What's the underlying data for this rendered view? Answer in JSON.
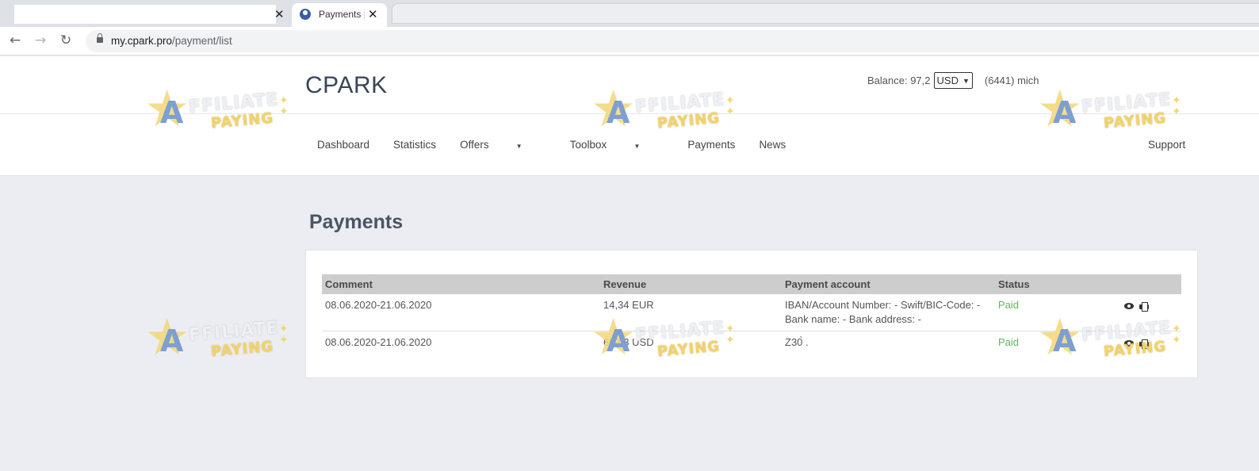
{
  "browser": {
    "tab_active_title": "Payments |",
    "close_glyph": "✕",
    "url_host": "my.cpark.pro",
    "url_path": "/payment/list"
  },
  "header": {
    "brand": "CPARK",
    "balance_label": "Balance: 97,2",
    "currency": "USD",
    "user": "(6441) mich"
  },
  "nav": {
    "items": [
      {
        "label": "Dashboard"
      },
      {
        "label": "Statistics"
      },
      {
        "label": "Offers",
        "dropdown": true
      },
      {
        "label": "Toolbox",
        "dropdown": true
      },
      {
        "label": "Payments"
      },
      {
        "label": "News"
      }
    ],
    "support": "Support"
  },
  "page": {
    "title": "Payments"
  },
  "table": {
    "columns": [
      "Comment",
      "Revenue",
      "Payment account",
      "Status"
    ],
    "rows": [
      {
        "comment": "08.06.2020-21.06.2020",
        "revenue": "14,34 EUR",
        "account_line1": "IBAN/Account Number: - Swift/BIC-Code: -",
        "account_line2": "Bank name: - Bank address: -",
        "status": "Paid"
      },
      {
        "comment": "08.06.2020-21.06.2020",
        "revenue": "693,3 USD",
        "account_line1": "Z30̀ .",
        "account_line2": "",
        "status": "Paid"
      }
    ]
  },
  "watermark": {
    "letter": "A",
    "line1": "FFILIATE",
    "line2": "PAYING"
  },
  "icons": {
    "back": "back-arrow-icon",
    "forward": "forward-arrow-icon",
    "reload": "reload-icon",
    "lock": "lock-icon",
    "view": "eye-icon",
    "print": "printer-icon"
  },
  "colors": {
    "paid": "#5cb85c",
    "page_bg": "#ecedf2",
    "table_header": "#cdcdcd"
  }
}
